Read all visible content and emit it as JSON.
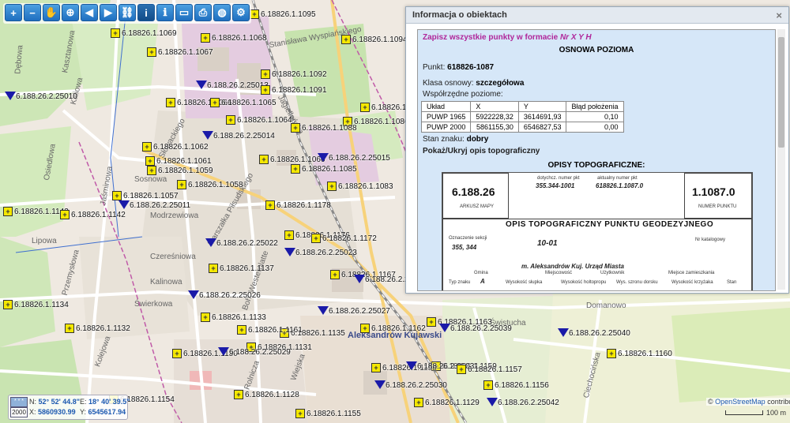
{
  "toolbar": {
    "buttons": [
      {
        "name": "zoom-in-icon",
        "glyph": "+"
      },
      {
        "name": "zoom-out-icon",
        "glyph": "−"
      },
      {
        "name": "pan-hand-icon",
        "glyph": "✋"
      },
      {
        "name": "zoom-box-icon",
        "glyph": "⊕"
      },
      {
        "name": "back-arrow-icon",
        "glyph": "◀"
      },
      {
        "name": "forward-arrow-icon",
        "glyph": "▶"
      },
      {
        "name": "link-icon",
        "glyph": "⛓"
      },
      {
        "name": "info-icon",
        "glyph": "i"
      },
      {
        "name": "object-info-icon",
        "glyph": "ℹ"
      },
      {
        "name": "measure-icon",
        "glyph": "▭"
      },
      {
        "name": "print-icon",
        "glyph": "⎙"
      },
      {
        "name": "globe-icon",
        "glyph": "◍"
      },
      {
        "name": "settings-icon",
        "glyph": "⚙"
      }
    ]
  },
  "panel": {
    "title": "Informacja o obiektach",
    "close": "×",
    "save_link_prefix": "Zapisz wszystkie punkty w formacie",
    "save_link_format": "Nr X Y H",
    "heading": "OSNOWA POZIOMA",
    "point_label": "Punkt:",
    "point_value": "618826-1087",
    "class_label": "Klasa osnowy:",
    "class_value": "szczegółowa",
    "coords_label": "Współrzędne poziome:",
    "table": {
      "headers": [
        "Układ",
        "X",
        "Y",
        "Błąd położenia"
      ],
      "rows": [
        [
          "PUWP 1965",
          "5922228,32",
          "3614691,93",
          "0,10"
        ],
        [
          "PUWP 2000",
          "5861155,30",
          "6546827,53",
          "0,00"
        ]
      ]
    },
    "state_label": "Stan znaku:",
    "state_value": "dobry",
    "toggle_link": "Pokaż/Ukryj opis topograficzny",
    "opis_title": "OPISY TOPOGRAFICZNE:",
    "doc": {
      "sheet_number": "6.188.26",
      "sheet_label": "ARKUSZ MAPY",
      "point_number": "1.1087.0",
      "point_label": "NUMER PUNKTU",
      "prev_number_label": "dotychcz. numer pkt",
      "prev_number": "355.344-1001",
      "current_number_label": "aktualny numer pkt",
      "current_number": "618826.1.1087.0",
      "form_title": "OPIS TOPOGRAFICZNY PUNKTU GEODEZYJNEGO",
      "section_label": "Oznaczenie sekcji",
      "section_value": "355, 344",
      "hand_number": "10-01",
      "place": "m. Aleksandrów  Kuj.  Urząd Miasta",
      "catalog_label": "Nr katalogowy",
      "row_labels": [
        "Gmina",
        "Miejscowość",
        "Użytkownik",
        "Miejsce zamieszkania",
        "Typ znaku",
        "Wysokość słupka",
        "Wysokość holtopropu",
        "Wys. szronu dorsku",
        "Wysokość krzyżaka",
        "Stan"
      ],
      "typ_value": "A"
    }
  },
  "coords": {
    "zoom_btn": "* * *",
    "zoom_value": "2000",
    "n_label": "N:",
    "n_value": "52° 52' 44.8\"",
    "e_label": "E:",
    "e_value": "18° 40' 39.5\"",
    "x_label": "X:",
    "x_value": "5860930.99",
    "y_label": "Y:",
    "y_value": "6545617.94"
  },
  "attribution": {
    "prefix": "©",
    "osm": "OpenStreetMap",
    "suffix": "contributors"
  },
  "scale": {
    "label": "100 m"
  },
  "map_labels": [
    "Stanisława Wyspiańskiego",
    "Kasztanowa",
    "Dębowa",
    "Kaliowa",
    "Osiedlowa",
    "Modrzewiowa",
    "Kalinowa",
    "Świerkowa",
    "Kolejowa",
    "Boh. Westerplatte",
    "Przemysłowa",
    "Lipowa",
    "Słowackiego",
    "Marszałka Piłsudskiego",
    "Aleksandrów Kujawski",
    "Jagiellońska",
    "Domanowo",
    "Świstucha",
    "Ciechocińska",
    "Wiejska",
    "Rolnicza",
    "Czereśniowa",
    "Jaśminowa",
    "Sosnowa"
  ],
  "points": [
    {
      "type": "sq",
      "id": "6.18826.1.1095"
    },
    {
      "type": "sq",
      "id": "6.18826.1.1069"
    },
    {
      "type": "sq",
      "id": "6.18826.1.1068"
    },
    {
      "type": "sq",
      "id": "6.18826.1.1094"
    },
    {
      "type": "sq",
      "id": "6.18826.1.1067"
    },
    {
      "type": "tri",
      "id": "6.188.26.2.25013"
    },
    {
      "type": "tri",
      "id": "6.188.26.2.25010"
    },
    {
      "type": "sq",
      "id": "6.18826.1.1066"
    },
    {
      "type": "sq",
      "id": "6.18826.1.1065"
    },
    {
      "type": "sq",
      "id": "6.18826.1.1092"
    },
    {
      "type": "sq",
      "id": "6.18826.1.1091"
    },
    {
      "type": "sq",
      "id": "6.18826.1.1089"
    },
    {
      "type": "sq",
      "id": "6.18826.1.1086"
    },
    {
      "type": "sq",
      "id": "6.18826.1.1064"
    },
    {
      "type": "sq",
      "id": "6.18826.1.1088"
    },
    {
      "type": "sq",
      "id": "6.18826.1.1062"
    },
    {
      "type": "tri",
      "id": "6.188.26.2.25014"
    },
    {
      "type": "sq",
      "id": "6.18826.1.1061"
    },
    {
      "type": "sq",
      "id": "6.18826.1.1060"
    },
    {
      "type": "sq",
      "id": "6.18826.1.1059"
    },
    {
      "type": "sq",
      "id": "6.18826.1.1085"
    },
    {
      "type": "tri",
      "id": "6.188.26.2.25015"
    },
    {
      "type": "sq",
      "id": "6.18826.1.1058"
    },
    {
      "type": "sq",
      "id": "6.18826.1.1083"
    },
    {
      "type": "sq",
      "id": "6.18826.1.1057"
    },
    {
      "type": "sq",
      "id": "6.18826.1.1143"
    },
    {
      "type": "sq",
      "id": "6.18826.1.1142"
    },
    {
      "type": "tri",
      "id": "6.188.26.2.25011"
    },
    {
      "type": "sq",
      "id": "6.18826.1.1178"
    },
    {
      "type": "sq",
      "id": "6.18826.1.1176"
    },
    {
      "type": "sq",
      "id": "6.18826.1.1172"
    },
    {
      "type": "tri",
      "id": "6.188.26.2.25022"
    },
    {
      "type": "tri",
      "id": "6.188.26.2.25023"
    },
    {
      "type": "sq",
      "id": "6.18826.1.1137"
    },
    {
      "type": "sq",
      "id": "6.18826.1.1167"
    },
    {
      "type": "tri",
      "id": "6.188.26.2.25025"
    },
    {
      "type": "sq",
      "id": "6.18826.1.1134"
    },
    {
      "type": "tri",
      "id": "6.188.26.2.25026"
    },
    {
      "type": "sq",
      "id": "6.18826.1.1133"
    },
    {
      "type": "tri",
      "id": "6.188.26.2.25027"
    },
    {
      "type": "sq",
      "id": "6.18826.1.1135"
    },
    {
      "type": "sq",
      "id": "6.18826.1.1161"
    },
    {
      "type": "sq",
      "id": "6.18826.1.1162"
    },
    {
      "type": "sq",
      "id": "6.18826.1.1163"
    },
    {
      "type": "sq",
      "id": "6.18826.1.1132"
    },
    {
      "type": "sq",
      "id": "6.18826.1.1131"
    },
    {
      "type": "tri",
      "id": "6.188.26.2.25039"
    },
    {
      "type": "tri",
      "id": "6.188.26.2.25040"
    },
    {
      "type": "sq",
      "id": "6.18826.1.1130"
    },
    {
      "type": "tri",
      "id": "6.188.26.2.25029"
    },
    {
      "type": "sq",
      "id": "6.18826.1.1160"
    },
    {
      "type": "sq",
      "id": "6.18826.1.1159"
    },
    {
      "type": "sq",
      "id": "6.18826.1.1158"
    },
    {
      "type": "tri",
      "id": "6.188.26.2.25031"
    },
    {
      "type": "sq",
      "id": "6.18826.1.1157"
    },
    {
      "type": "tri",
      "id": "6.188.26.2.25030"
    },
    {
      "type": "sq",
      "id": "6.18826.1.1156"
    },
    {
      "type": "sq",
      "id": "6.18826.1.1129"
    },
    {
      "type": "sq",
      "id": "6.18826.1.1128"
    },
    {
      "type": "sq",
      "id": "6.18826.1.1154"
    },
    {
      "type": "sq",
      "id": "6.18826.1.1155"
    },
    {
      "type": "tri",
      "id": "6.188.26.2.25042"
    }
  ]
}
